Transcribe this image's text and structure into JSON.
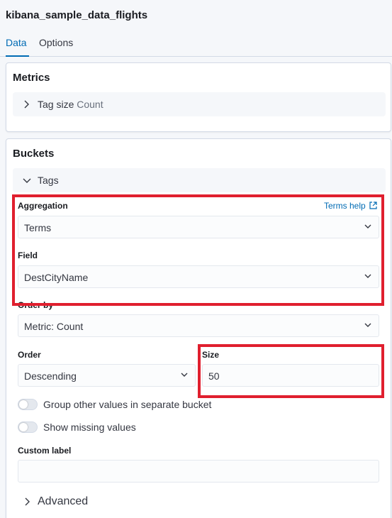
{
  "header": {
    "title": "kibana_sample_data_flights",
    "tabs": [
      {
        "label": "Data",
        "active": true
      },
      {
        "label": "Options",
        "active": false
      }
    ]
  },
  "metrics": {
    "heading": "Metrics",
    "item": {
      "label": "Tag size",
      "value": "Count"
    }
  },
  "buckets": {
    "heading": "Buckets",
    "group_label": "Tags",
    "aggregation": {
      "label": "Aggregation",
      "help_label": "Terms help",
      "value": "Terms"
    },
    "field": {
      "label": "Field",
      "value": "DestCityName"
    },
    "order_by": {
      "label": "Order by",
      "value": "Metric: Count"
    },
    "order": {
      "label": "Order",
      "value": "Descending"
    },
    "size": {
      "label": "Size",
      "value": "50"
    },
    "switches": [
      {
        "label": "Group other values in separate bucket",
        "checked": false
      },
      {
        "label": "Show missing values",
        "checked": false
      }
    ],
    "custom_label": {
      "label": "Custom label",
      "value": ""
    },
    "advanced_label": "Advanced"
  },
  "colors": {
    "accent": "#006bb4",
    "highlight": "#e01f2e"
  }
}
